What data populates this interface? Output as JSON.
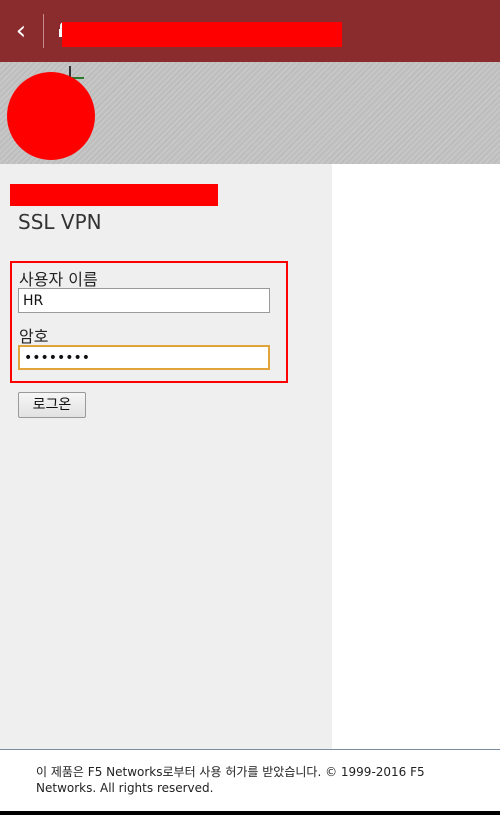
{
  "topbar": {
    "back_glyph": "‹",
    "title": ""
  },
  "main": {
    "heading": "",
    "vpn_title": "SSL VPN",
    "username_label": "사용자 이름",
    "username_value": "HR",
    "password_label": "암호",
    "password_value": "••••••••",
    "login_button": "로그온"
  },
  "footer": {
    "text": "이 제품은 F5 Networks로부터 사용 허가를 받았습니다. © 1999-2016 F5 Networks. All rights reserved."
  },
  "colors": {
    "topbar": "#8a2b2e",
    "panel": "#efefef",
    "focus_border": "#e0a43a",
    "highlight": "#ff0000"
  }
}
